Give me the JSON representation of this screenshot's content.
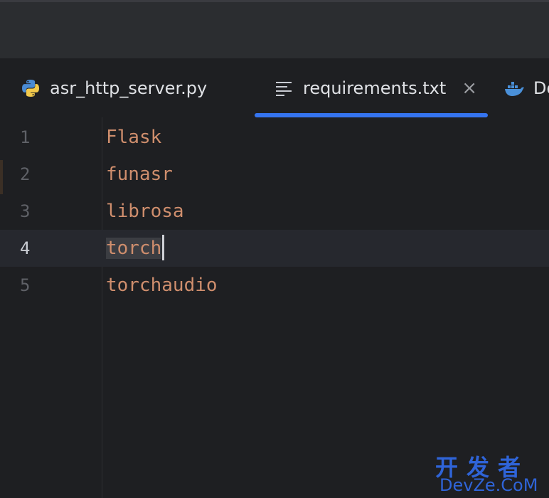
{
  "tabs": [
    {
      "label": "asr_http_server.py",
      "icon": "python-file-icon",
      "active": false
    },
    {
      "label": "requirements.txt",
      "icon": "text-file-icon",
      "active": true,
      "close": "×"
    },
    {
      "label": "Do",
      "icon": "docker-icon",
      "active": false
    }
  ],
  "editor": {
    "lines": [
      {
        "number": "1",
        "text": "Flask"
      },
      {
        "number": "2",
        "text": "funasr"
      },
      {
        "number": "3",
        "text": "librosa"
      },
      {
        "number": "4",
        "text": "torch"
      },
      {
        "number": "5",
        "text": "torchaudio"
      }
    ],
    "current_line": 4
  },
  "watermark": {
    "top": "开发者",
    "bottom": "DevZe.CoM"
  },
  "colors": {
    "accent": "#3574f0",
    "code_text": "#cf8e6d",
    "background": "#1e1f22"
  }
}
